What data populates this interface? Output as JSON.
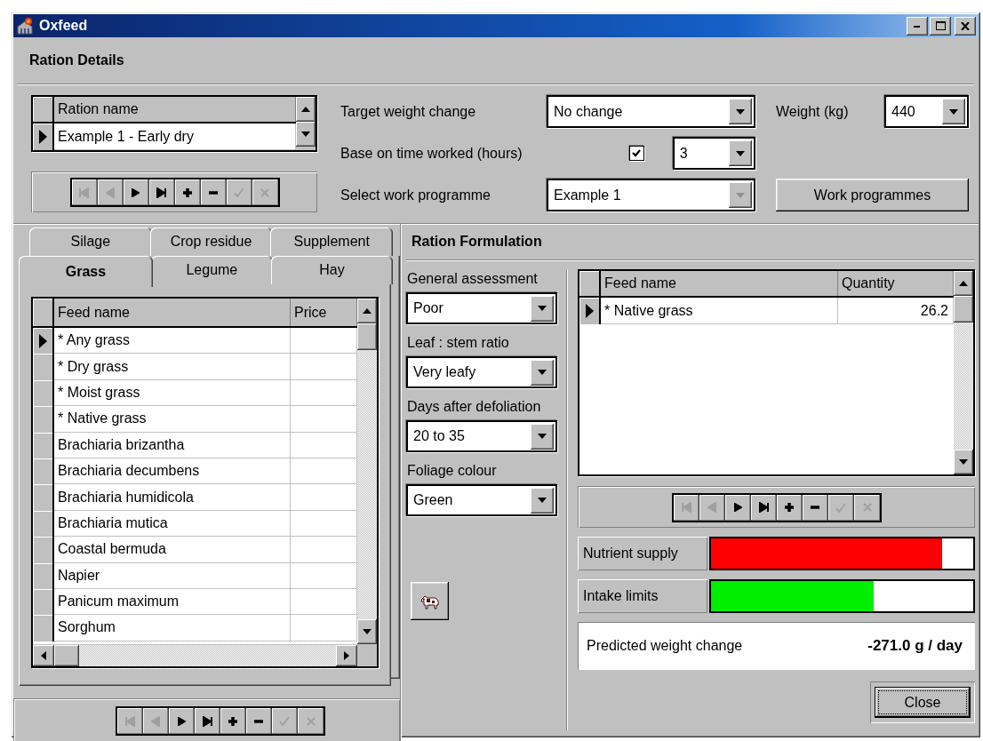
{
  "window": {
    "title": "Oxfeed"
  },
  "ration_details": {
    "title": "Ration Details",
    "ration_grid": {
      "columns": [
        "Ration name"
      ],
      "rows": [
        {
          "name": "Example 1 - Early dry",
          "selected": true
        }
      ]
    },
    "navigator": [
      {
        "kind": "first",
        "disabled": true
      },
      {
        "kind": "prior",
        "disabled": true
      },
      {
        "kind": "next",
        "disabled": false
      },
      {
        "kind": "last",
        "disabled": false
      },
      {
        "kind": "insert",
        "disabled": false
      },
      {
        "kind": "delete",
        "disabled": false
      },
      {
        "kind": "post",
        "disabled": true
      },
      {
        "kind": "cancel",
        "disabled": true
      }
    ],
    "target_weight_change": {
      "label": "Target weight change",
      "value": "No change"
    },
    "weight": {
      "label": "Weight (kg)",
      "value": "440"
    },
    "time_worked": {
      "label": "Base on time worked (hours)",
      "checked": true,
      "value": "3"
    },
    "work_programme": {
      "label": "Select work programme",
      "value": "Example 1",
      "disabled": true
    },
    "work_programmes_button": "Work programmes"
  },
  "feed_tabs": [
    [
      {
        "label": "Silage",
        "selected": false
      },
      {
        "label": "Crop residue",
        "selected": false
      },
      {
        "label": "Supplement",
        "selected": false
      }
    ],
    [
      {
        "label": "Grass",
        "selected": true
      },
      {
        "label": "Legume",
        "selected": false
      },
      {
        "label": "Hay",
        "selected": false
      }
    ]
  ],
  "feed_grid": {
    "columns": [
      "Feed name",
      "Price"
    ],
    "rows": [
      {
        "name": "* Any grass",
        "selected": true
      },
      {
        "name": "* Dry grass",
        "selected": false
      },
      {
        "name": "* Moist grass",
        "selected": false
      },
      {
        "name": "* Native grass",
        "selected": false
      },
      {
        "name": "Brachiaria brizantha",
        "selected": false
      },
      {
        "name": "Brachiaria decumbens",
        "selected": false
      },
      {
        "name": "Brachiaria humidicola",
        "selected": false
      },
      {
        "name": "Brachiaria mutica",
        "selected": false
      },
      {
        "name": "Coastal bermuda",
        "selected": false
      },
      {
        "name": "Napier",
        "selected": false
      },
      {
        "name": "Panicum maximum",
        "selected": false
      },
      {
        "name": "Sorghum",
        "selected": false
      }
    ]
  },
  "feed_navigator": [
    {
      "kind": "first",
      "disabled": true
    },
    {
      "kind": "prior",
      "disabled": true
    },
    {
      "kind": "next",
      "disabled": false
    },
    {
      "kind": "last",
      "disabled": false
    },
    {
      "kind": "insert",
      "disabled": false
    },
    {
      "kind": "delete",
      "disabled": false
    },
    {
      "kind": "post",
      "disabled": true
    },
    {
      "kind": "cancel",
      "disabled": true
    }
  ],
  "ration_formulation": {
    "title": "Ration Formulation",
    "assessments": [
      {
        "label": "General assessment",
        "value": "Poor"
      },
      {
        "label": "Leaf : stem ratio",
        "value": "Very leafy"
      },
      {
        "label": "Days after defoliation",
        "value": "20 to 35"
      },
      {
        "label": "Foliage colour",
        "value": "Green"
      }
    ],
    "grid": {
      "columns": [
        "Feed name",
        "Quantity"
      ],
      "rows": [
        {
          "name": "* Native grass",
          "quantity": "26.2",
          "selected": true
        }
      ]
    },
    "navigator": [
      {
        "kind": "first",
        "disabled": true
      },
      {
        "kind": "prior",
        "disabled": true
      },
      {
        "kind": "next",
        "disabled": false
      },
      {
        "kind": "last",
        "disabled": false
      },
      {
        "kind": "insert",
        "disabled": false
      },
      {
        "kind": "delete",
        "disabled": false
      },
      {
        "kind": "post",
        "disabled": true
      },
      {
        "kind": "cancel",
        "disabled": true
      }
    ],
    "meters": [
      {
        "label": "Nutrient supply",
        "level": 0.88,
        "color": "#ff0000"
      },
      {
        "label": "Intake limits",
        "level": 0.62,
        "color": "#00ee00"
      }
    ],
    "predicted": {
      "label": "Predicted weight change",
      "value": "-271.0 g / day"
    },
    "close_button": "Close"
  }
}
